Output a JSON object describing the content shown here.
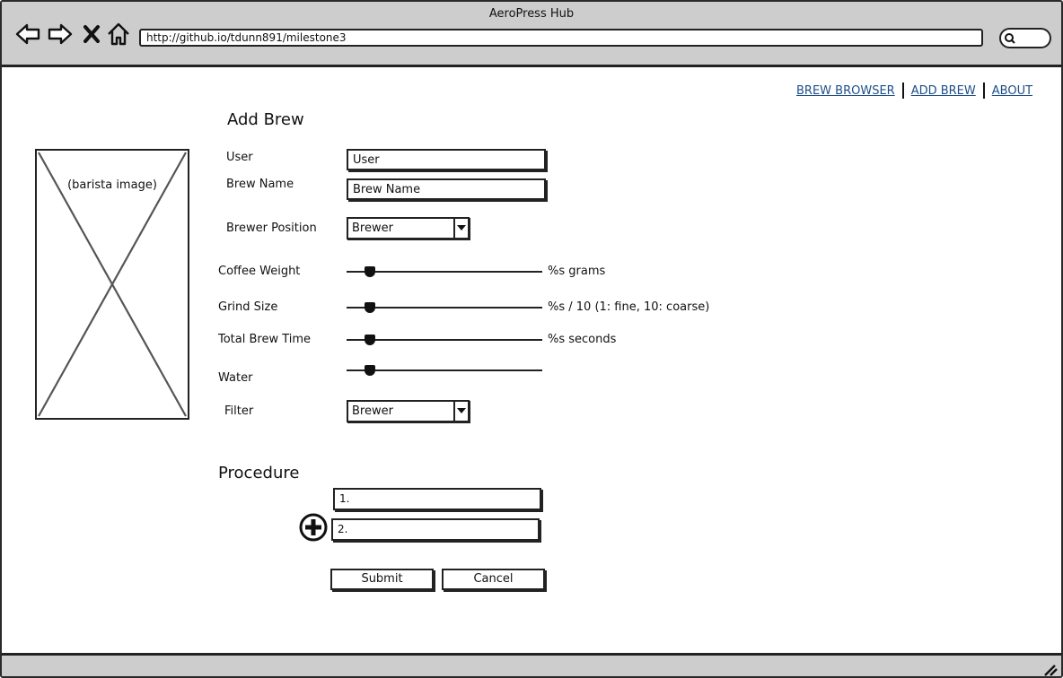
{
  "window": {
    "title": "AeroPress Hub"
  },
  "browser": {
    "url": "http://github.io/tdunn891/milestone3",
    "icons": [
      "back-arrow-icon",
      "forward-arrow-icon",
      "close-x-icon",
      "home-icon",
      "search-icon"
    ]
  },
  "nav": {
    "brew_browser": "BREW BROWSER",
    "add_brew": "ADD BREW",
    "about": "ABOUT"
  },
  "image_placeholder": {
    "label": "(barista image)"
  },
  "form": {
    "title": "Add Brew",
    "user": {
      "label": "User",
      "value": "User"
    },
    "brew_name": {
      "label": "Brew Name",
      "value": "Brew Name"
    },
    "brewer_position": {
      "label": "Brewer Position",
      "value": "Brewer"
    },
    "coffee_weight": {
      "label": "Coffee Weight",
      "unit": "%s grams",
      "level": 0.07
    },
    "grind_size": {
      "label": "Grind Size",
      "unit": "%s / 10 (1: fine, 10: coarse)",
      "level": 0.07
    },
    "total_brew_time": {
      "label": "Total Brew Time",
      "unit": "%s seconds",
      "level": 0.07
    },
    "water": {
      "label": "Water",
      "level": 0.07
    },
    "filter": {
      "label": "Filter",
      "value": "Brewer"
    }
  },
  "procedure": {
    "title": "Procedure",
    "steps": [
      "1.",
      "2."
    ],
    "add_icon": "plus-circle-icon"
  },
  "actions": {
    "submit": "Submit",
    "cancel": "Cancel"
  }
}
